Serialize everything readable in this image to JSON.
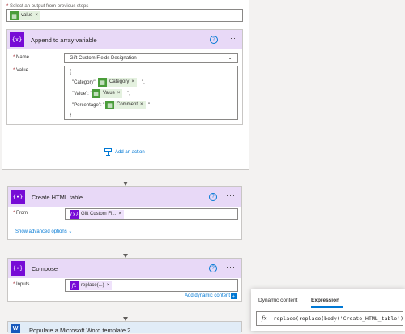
{
  "loop": {
    "prev_label_req": "*",
    "prev_label": " Select an output from previous steps",
    "token_value": "value"
  },
  "append": {
    "title": "Append to array variable",
    "icon_text": "{x}",
    "name_label": "Name",
    "name_value": "Gift Custom Fields Designation",
    "value_label": "Value",
    "brace_open": "{",
    "line1_key": "\"Category\": \"",
    "line1_token": "Category",
    "line1_tail": "\",",
    "line2_key": "\"Value\": \"",
    "line2_token": "Value",
    "line2_tail": "\",",
    "line3_key": "\"Percentage\": \"",
    "line3_token": "Comment",
    "line3_tail": "\"",
    "brace_close": "}"
  },
  "add_action": "Add an action",
  "html_table": {
    "title": "Create HTML table",
    "icon_text": "{∙}",
    "from_label": "From",
    "from_token": "Gift Custom Fi...",
    "advanced": "Show advanced options"
  },
  "compose": {
    "title": "Compose",
    "icon_text": "{∙}",
    "inputs_label": "Inputs",
    "inputs_token": "replace(...)",
    "add_dynamic": "Add dynamic content"
  },
  "dynamic_panel": {
    "tab_dynamic": "Dynamic content",
    "tab_expression": "Expression",
    "fx": "fx",
    "expression": "replace(replace(body('Create_HTML_table'), '&lt;', '<'), '&gt;', '>')"
  },
  "word": {
    "title": "Populate a Microsoft Word template 2",
    "icon_text": "W"
  },
  "common": {
    "required_mark": "*",
    "help_mark": "?",
    "more_mark": "···",
    "close_mark": "×",
    "chevron": "⌄"
  },
  "colors": {
    "purple_header": "#e8d9f7",
    "purple_icon": "#770bd6",
    "green_token": "#4a9d3a",
    "link_blue": "#0078d4"
  }
}
